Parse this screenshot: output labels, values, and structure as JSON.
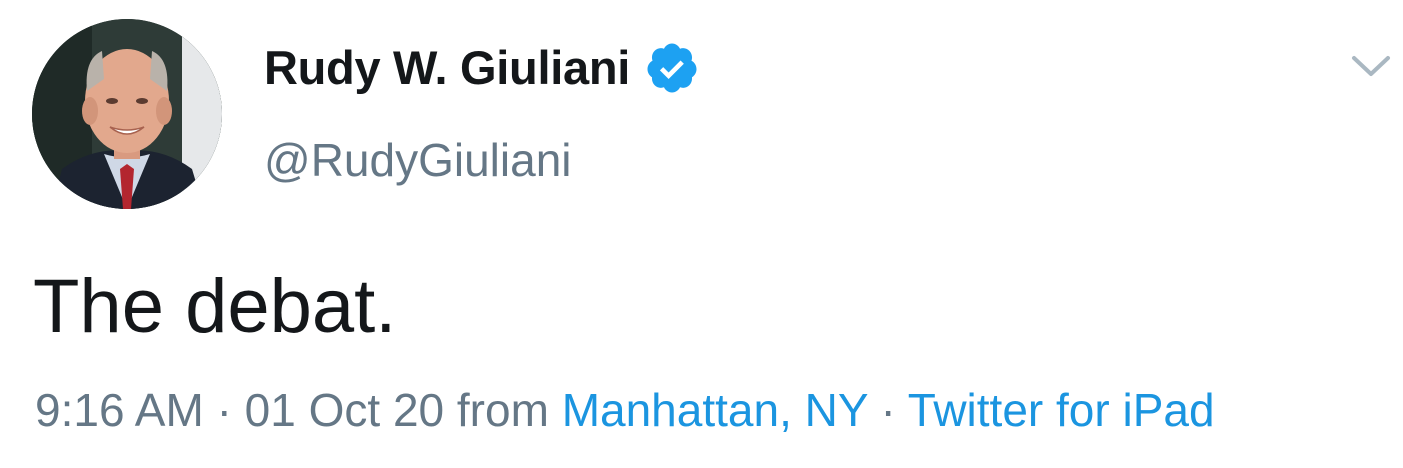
{
  "tweet": {
    "author": {
      "display_name": "Rudy W. Giuliani",
      "handle": "@RudyGiuliani",
      "verified": true,
      "avatar_icon": "profile-photo"
    },
    "text": "The debat.",
    "meta": {
      "time": "9:16 AM",
      "separator": "·",
      "date": "01 Oct 20",
      "from_label": "from",
      "location": "Manhattan, NY",
      "source": "Twitter for iPad"
    },
    "menu_icon": "chevron-down-icon"
  },
  "colors": {
    "text_primary": "#14171a",
    "text_secondary": "#657786",
    "link": "#1b95e0",
    "verified_badge": "#1da1f2"
  }
}
